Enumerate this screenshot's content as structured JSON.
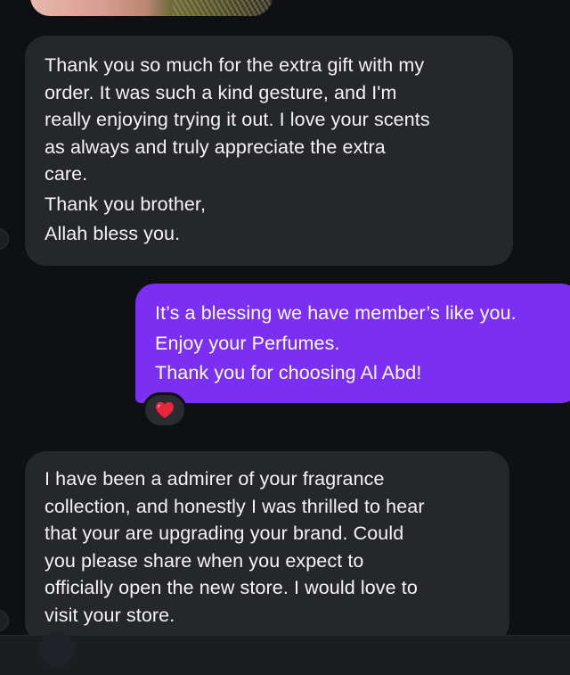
{
  "conversation": {
    "messages": [
      {
        "direction": "incoming",
        "lines": [
          "Thank you so much for the extra gift with my",
          "order. It was such a kind gesture, and I'm",
          "really enjoying trying it out. I love your scents",
          "as always and truly appreciate the extra",
          "care.",
          "Thank you brother,",
          "Allah bless you."
        ]
      },
      {
        "direction": "outgoing",
        "lines": [
          "It’s a blessing we have member’s like you.",
          "Enjoy your Perfumes.",
          "Thank you for choosing Al Abd!"
        ],
        "reaction_icon": "red-heart-icon"
      },
      {
        "direction": "incoming",
        "lines": [
          "I have been a admirer of your fragrance",
          "collection, and honestly I was thrilled to hear",
          "that your are upgrading your brand. Could",
          "you please share when you expect to",
          "officially open the new store. I would love to",
          "visit your store."
        ]
      }
    ]
  },
  "colors": {
    "background": "#0e1013",
    "incoming_bubble": "#25272b",
    "outgoing_bubble": "#7a2ff3",
    "heart": "#e8253a"
  }
}
